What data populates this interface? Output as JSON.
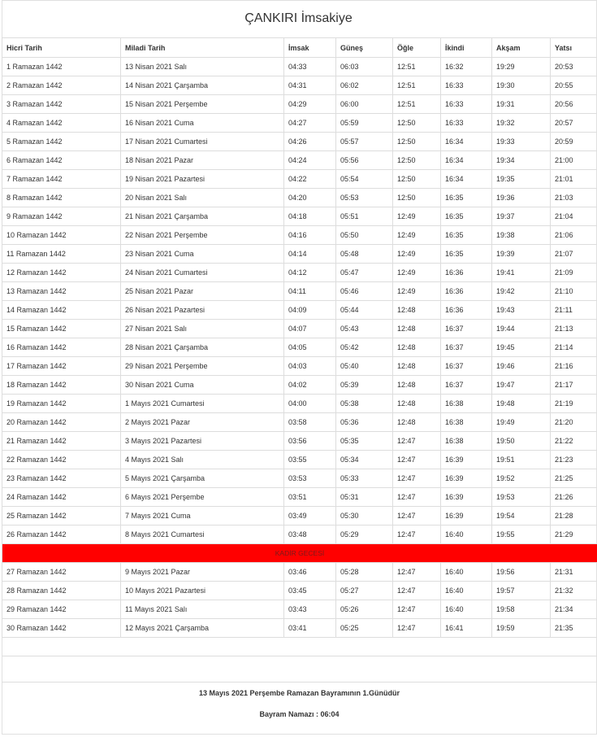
{
  "page_title": "ÇANKIRI İmsakiye",
  "columns": [
    "Hicri Tarih",
    "Miladi Tarih",
    "İmsak",
    "Güneş",
    "Öğle",
    "İkindi",
    "Akşam",
    "Yatsı"
  ],
  "rows_part1": [
    [
      "1 Ramazan 1442",
      "13 Nisan 2021 Salı",
      "04:33",
      "06:03",
      "12:51",
      "16:32",
      "19:29",
      "20:53"
    ],
    [
      "2 Ramazan 1442",
      "14 Nisan 2021 Çarşamba",
      "04:31",
      "06:02",
      "12:51",
      "16:33",
      "19:30",
      "20:55"
    ],
    [
      "3 Ramazan 1442",
      "15 Nisan 2021 Perşembe",
      "04:29",
      "06:00",
      "12:51",
      "16:33",
      "19:31",
      "20:56"
    ],
    [
      "4 Ramazan 1442",
      "16 Nisan 2021 Cuma",
      "04:27",
      "05:59",
      "12:50",
      "16:33",
      "19:32",
      "20:57"
    ],
    [
      "5 Ramazan 1442",
      "17 Nisan 2021 Cumartesi",
      "04:26",
      "05:57",
      "12:50",
      "16:34",
      "19:33",
      "20:59"
    ],
    [
      "6 Ramazan 1442",
      "18 Nisan 2021 Pazar",
      "04:24",
      "05:56",
      "12:50",
      "16:34",
      "19:34",
      "21:00"
    ],
    [
      "7 Ramazan 1442",
      "19 Nisan 2021 Pazartesi",
      "04:22",
      "05:54",
      "12:50",
      "16:34",
      "19:35",
      "21:01"
    ],
    [
      "8 Ramazan 1442",
      "20 Nisan 2021 Salı",
      "04:20",
      "05:53",
      "12:50",
      "16:35",
      "19:36",
      "21:03"
    ],
    [
      "9 Ramazan 1442",
      "21 Nisan 2021 Çarşamba",
      "04:18",
      "05:51",
      "12:49",
      "16:35",
      "19:37",
      "21:04"
    ],
    [
      "10 Ramazan 1442",
      "22 Nisan 2021 Perşembe",
      "04:16",
      "05:50",
      "12:49",
      "16:35",
      "19:38",
      "21:06"
    ],
    [
      "11 Ramazan 1442",
      "23 Nisan 2021 Cuma",
      "04:14",
      "05:48",
      "12:49",
      "16:35",
      "19:39",
      "21:07"
    ],
    [
      "12 Ramazan 1442",
      "24 Nisan 2021 Cumartesi",
      "04:12",
      "05:47",
      "12:49",
      "16:36",
      "19:41",
      "21:09"
    ],
    [
      "13 Ramazan 1442",
      "25 Nisan 2021 Pazar",
      "04:11",
      "05:46",
      "12:49",
      "16:36",
      "19:42",
      "21:10"
    ],
    [
      "14 Ramazan 1442",
      "26 Nisan 2021 Pazartesi",
      "04:09",
      "05:44",
      "12:48",
      "16:36",
      "19:43",
      "21:11"
    ],
    [
      "15 Ramazan 1442",
      "27 Nisan 2021 Salı",
      "04:07",
      "05:43",
      "12:48",
      "16:37",
      "19:44",
      "21:13"
    ],
    [
      "16 Ramazan 1442",
      "28 Nisan 2021 Çarşamba",
      "04:05",
      "05:42",
      "12:48",
      "16:37",
      "19:45",
      "21:14"
    ],
    [
      "17 Ramazan 1442",
      "29 Nisan 2021 Perşembe",
      "04:03",
      "05:40",
      "12:48",
      "16:37",
      "19:46",
      "21:16"
    ],
    [
      "18 Ramazan 1442",
      "30 Nisan 2021 Cuma",
      "04:02",
      "05:39",
      "12:48",
      "16:37",
      "19:47",
      "21:17"
    ],
    [
      "19 Ramazan 1442",
      "1 Mayıs 2021 Cumartesi",
      "04:00",
      "05:38",
      "12:48",
      "16:38",
      "19:48",
      "21:19"
    ],
    [
      "20 Ramazan 1442",
      "2 Mayıs 2021 Pazar",
      "03:58",
      "05:36",
      "12:48",
      "16:38",
      "19:49",
      "21:20"
    ],
    [
      "21 Ramazan 1442",
      "3 Mayıs 2021 Pazartesi",
      "03:56",
      "05:35",
      "12:47",
      "16:38",
      "19:50",
      "21:22"
    ],
    [
      "22 Ramazan 1442",
      "4 Mayıs 2021 Salı",
      "03:55",
      "05:34",
      "12:47",
      "16:39",
      "19:51",
      "21:23"
    ],
    [
      "23 Ramazan 1442",
      "5 Mayıs 2021 Çarşamba",
      "03:53",
      "05:33",
      "12:47",
      "16:39",
      "19:52",
      "21:25"
    ],
    [
      "24 Ramazan 1442",
      "6 Mayıs 2021 Perşembe",
      "03:51",
      "05:31",
      "12:47",
      "16:39",
      "19:53",
      "21:26"
    ],
    [
      "25 Ramazan 1442",
      "7 Mayıs 2021 Cuma",
      "03:49",
      "05:30",
      "12:47",
      "16:39",
      "19:54",
      "21:28"
    ],
    [
      "26 Ramazan 1442",
      "8 Mayıs 2021 Cumartesi",
      "03:48",
      "05:29",
      "12:47",
      "16:40",
      "19:55",
      "21:29"
    ]
  ],
  "kadir_label": "KADİR GECESİ",
  "kadir_color": "#ff0000",
  "rows_part2": [
    [
      "27 Ramazan 1442",
      "9 Mayıs 2021 Pazar",
      "03:46",
      "05:28",
      "12:47",
      "16:40",
      "19:56",
      "21:31"
    ],
    [
      "28 Ramazan 1442",
      "10 Mayıs 2021 Pazartesi",
      "03:45",
      "05:27",
      "12:47",
      "16:40",
      "19:57",
      "21:32"
    ],
    [
      "29 Ramazan 1442",
      "11 Mayıs 2021 Salı",
      "03:43",
      "05:26",
      "12:47",
      "16:40",
      "19:58",
      "21:34"
    ],
    [
      "30 Ramazan 1442",
      "12 Mayıs 2021 Çarşamba",
      "03:41",
      "05:25",
      "12:47",
      "16:41",
      "19:59",
      "21:35"
    ]
  ],
  "footer": {
    "bayram_text": "13 Mayıs 2021 Perşembe Ramazan Bayramının 1.Günüdür",
    "namaz_text": "Bayram Namazı : 06:04"
  }
}
